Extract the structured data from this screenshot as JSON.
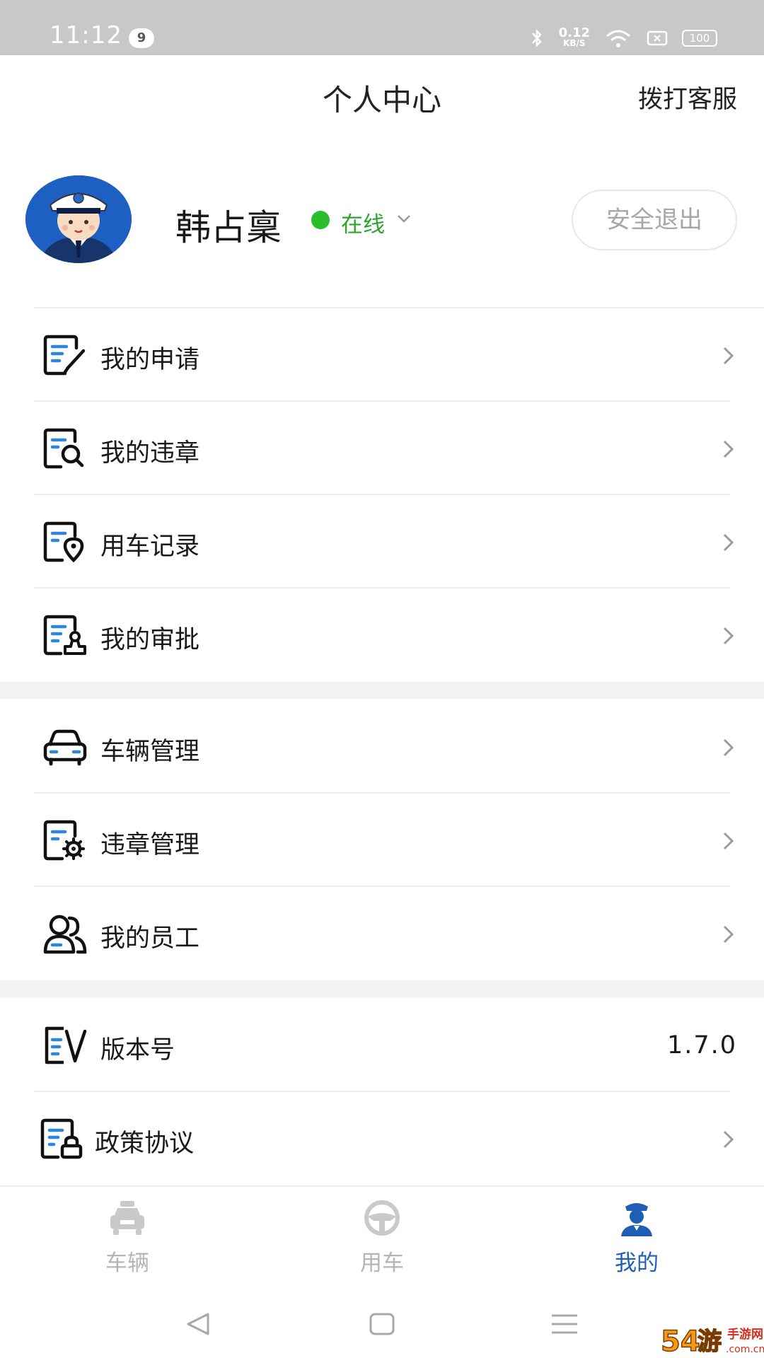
{
  "status_bar": {
    "time": "11:12",
    "notification_count": "9",
    "net_speed_value": "0.12",
    "net_speed_unit": "KB/S",
    "battery": "100"
  },
  "header": {
    "title": "个人中心",
    "action_label": "拨打客服"
  },
  "profile": {
    "name": "韩占稟",
    "status": "在线",
    "status_color": "#2bbd2b",
    "logout_label": "安全退出"
  },
  "menu_groups": [
    {
      "items": [
        {
          "label": "我的申请",
          "icon": "edit-document-icon"
        },
        {
          "label": "我的违章",
          "icon": "document-search-icon"
        },
        {
          "label": "用车记录",
          "icon": "document-location-icon"
        },
        {
          "label": "我的审批",
          "icon": "document-stamp-icon"
        }
      ]
    },
    {
      "items": [
        {
          "label": "车辆管理",
          "icon": "car-icon"
        },
        {
          "label": "违章管理",
          "icon": "document-gear-icon"
        },
        {
          "label": "我的员工",
          "icon": "staff-icon"
        }
      ]
    },
    {
      "items": [
        {
          "label": "版本号",
          "icon": "version-icon",
          "value": "1.7.0"
        },
        {
          "label": "政策协议",
          "icon": "document-lock-icon"
        }
      ]
    }
  ],
  "tabbar": {
    "tabs": [
      {
        "label": "车辆",
        "icon": "police-car-icon",
        "active": false
      },
      {
        "label": "用车",
        "icon": "steering-wheel-icon",
        "active": false
      },
      {
        "label": "我的",
        "icon": "police-officer-icon",
        "active": true
      }
    ],
    "active_color": "#1e5fb5"
  },
  "watermark": {
    "text": "54游手游网 .com.cn"
  }
}
